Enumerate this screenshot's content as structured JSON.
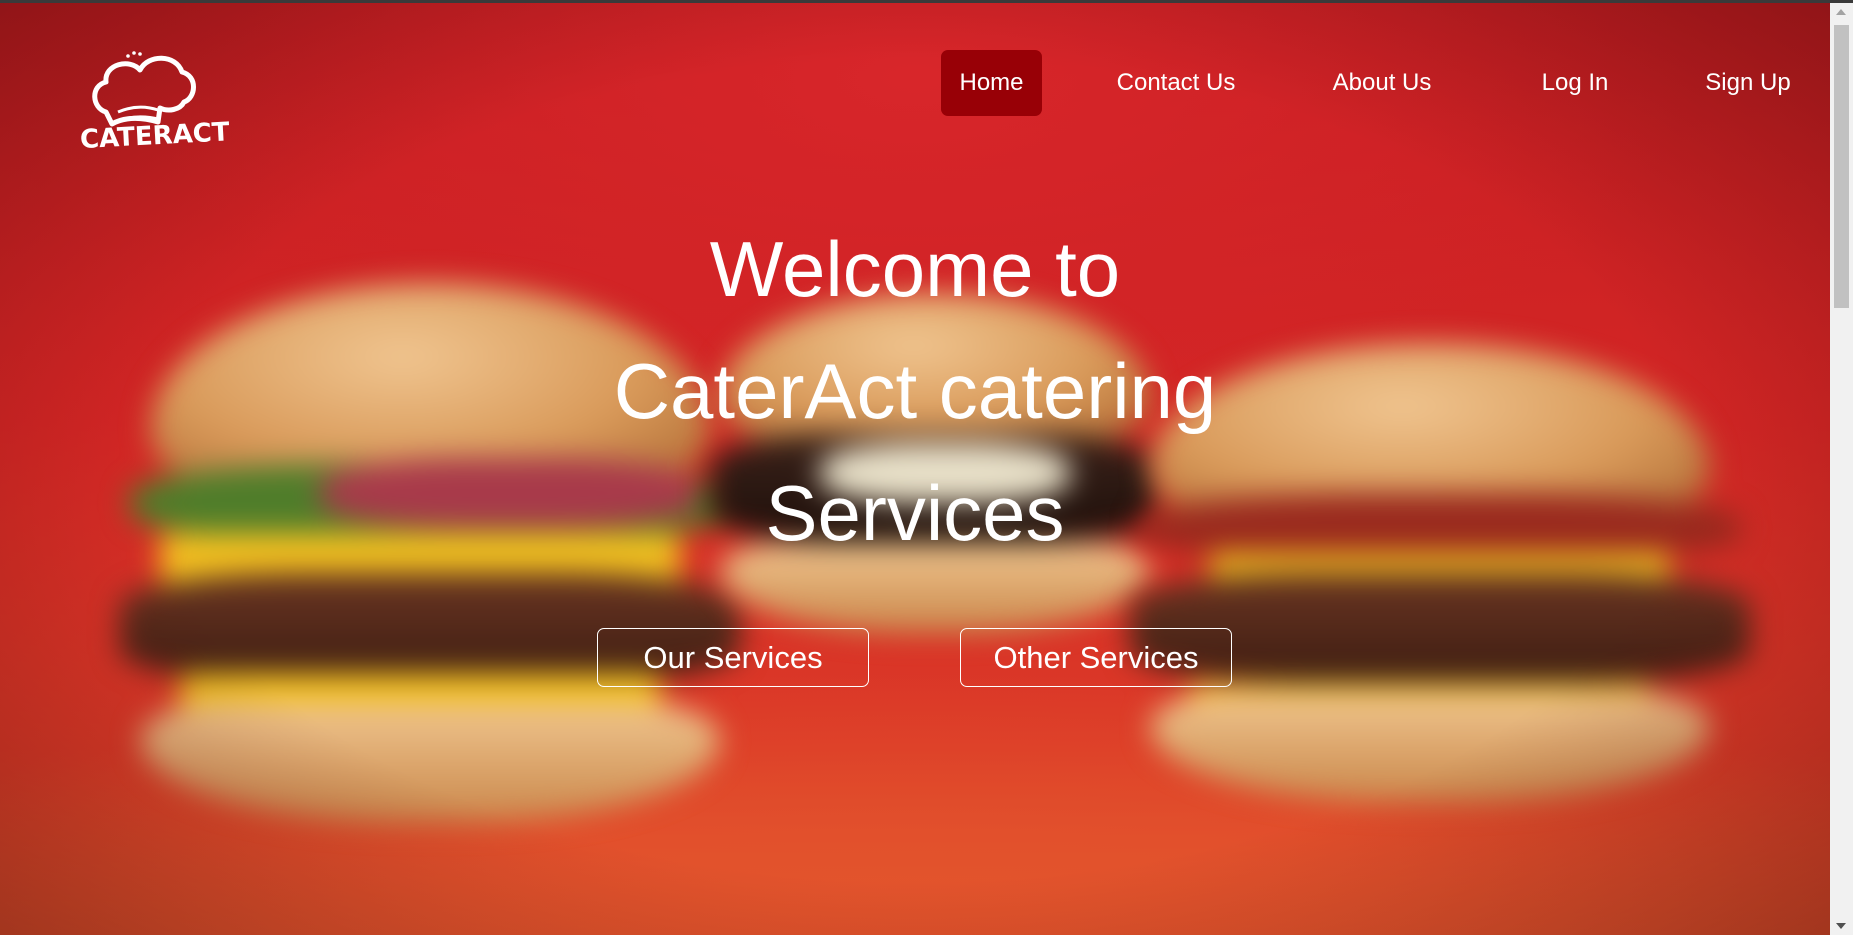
{
  "brand": {
    "logo_text": "CATERACT"
  },
  "nav": {
    "items": [
      {
        "label": "Home",
        "active": true
      },
      {
        "label": "Contact Us",
        "active": false
      },
      {
        "label": "About Us",
        "active": false
      },
      {
        "label": "Log In",
        "active": false
      },
      {
        "label": "Sign Up",
        "active": false
      }
    ]
  },
  "hero": {
    "headline_lines": [
      "Welcome to",
      "CaterAct catering",
      "Services"
    ],
    "buttons": {
      "our_services": "Our Services",
      "other_services": "Other Services"
    },
    "background": "blurred burgers on red background"
  },
  "colors": {
    "active_nav_bg": "#980006",
    "hero_red": "#c81d22",
    "text": "#ffffff"
  }
}
